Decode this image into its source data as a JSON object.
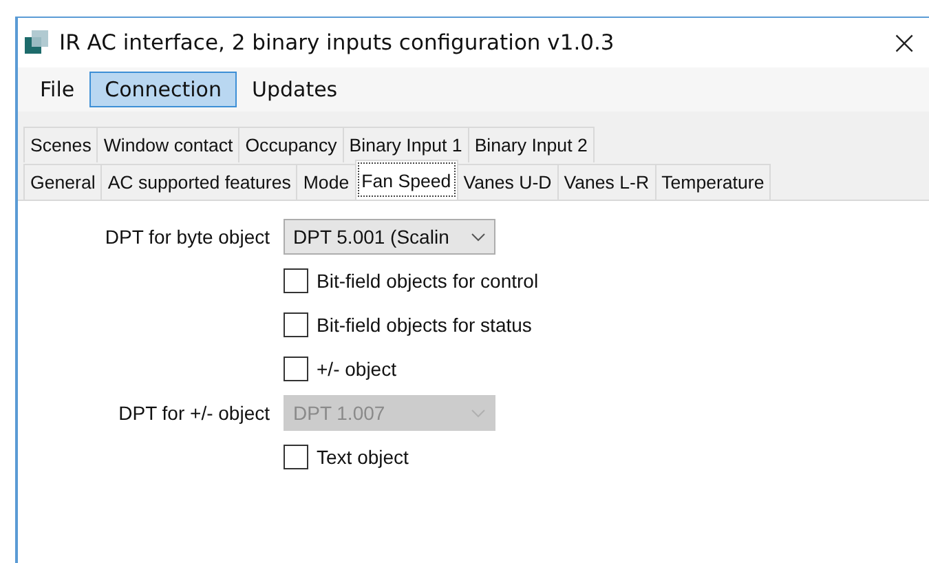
{
  "window": {
    "title": "IR AC interface, 2 binary inputs configuration v1.0.3",
    "close": "×"
  },
  "menu": [
    {
      "label": "File",
      "selected": false
    },
    {
      "label": "Connection",
      "selected": true
    },
    {
      "label": "Updates",
      "selected": false
    }
  ],
  "tab_rows": [
    {
      "tabs": [
        {
          "label": "Scenes",
          "selected": false
        },
        {
          "label": "Window contact",
          "selected": false
        },
        {
          "label": "Occupancy",
          "selected": false
        },
        {
          "label": "Binary Input 1",
          "selected": false
        },
        {
          "label": "Binary Input 2",
          "selected": false
        }
      ]
    },
    {
      "tabs": [
        {
          "label": "General",
          "selected": false
        },
        {
          "label": "AC supported features",
          "selected": false
        },
        {
          "label": "Mode",
          "selected": false
        },
        {
          "label": "Fan Speed",
          "selected": true
        },
        {
          "label": "Vanes U-D",
          "selected": false
        },
        {
          "label": "Vanes L-R",
          "selected": false
        },
        {
          "label": "Temperature",
          "selected": false
        }
      ]
    }
  ],
  "form": [
    {
      "kind": "select",
      "label": "DPT for byte object",
      "value": "DPT 5.001 (Scalin",
      "disabled": false
    },
    {
      "kind": "checkbox",
      "label": "Bit-field objects for control",
      "checked": false
    },
    {
      "kind": "checkbox",
      "label": "Bit-field objects for status",
      "checked": false
    },
    {
      "kind": "checkbox",
      "label": "+/- object",
      "checked": false
    },
    {
      "kind": "select",
      "label": "DPT for +/- object",
      "value": "DPT 1.007",
      "disabled": true
    },
    {
      "kind": "checkbox",
      "label": "Text object",
      "checked": false
    }
  ]
}
